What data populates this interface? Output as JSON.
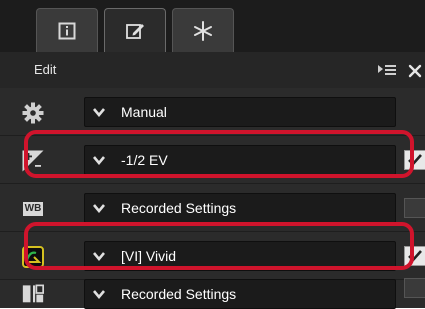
{
  "tabs": [
    {
      "name": "info-tab",
      "icon": "info-icon",
      "active": false
    },
    {
      "name": "edit-tab",
      "icon": "edit-pencil-icon",
      "active": true
    },
    {
      "name": "effects-tab",
      "icon": "sparkle-icon",
      "active": false
    }
  ],
  "header": {
    "title": "Edit",
    "menu_icon": "panel-menu-icon",
    "close_icon": "close-icon"
  },
  "rows": [
    {
      "icon": "gear-icon",
      "value": "Manual",
      "checkbox": "none"
    },
    {
      "icon": "exposure-compensation-icon",
      "value": "-1/2 EV",
      "checkbox": "checked",
      "highlighted": true
    },
    {
      "icon": "white-balance-icon",
      "value": "Recorded Settings",
      "checkbox": "unchecked"
    },
    {
      "icon": "picture-control-icon",
      "value": "[VI] Vivid",
      "checkbox": "checked",
      "highlighted": true
    },
    {
      "icon": "active-d-lighting-icon",
      "value": "Recorded Settings",
      "checkbox": "unchecked"
    }
  ],
  "labels": {
    "wb": "WB"
  },
  "colors": {
    "highlight": "#d0142c",
    "panel_bg": "#2b2b2b",
    "dropdown_bg": "#1b1b1b",
    "text": "#ffffff"
  }
}
